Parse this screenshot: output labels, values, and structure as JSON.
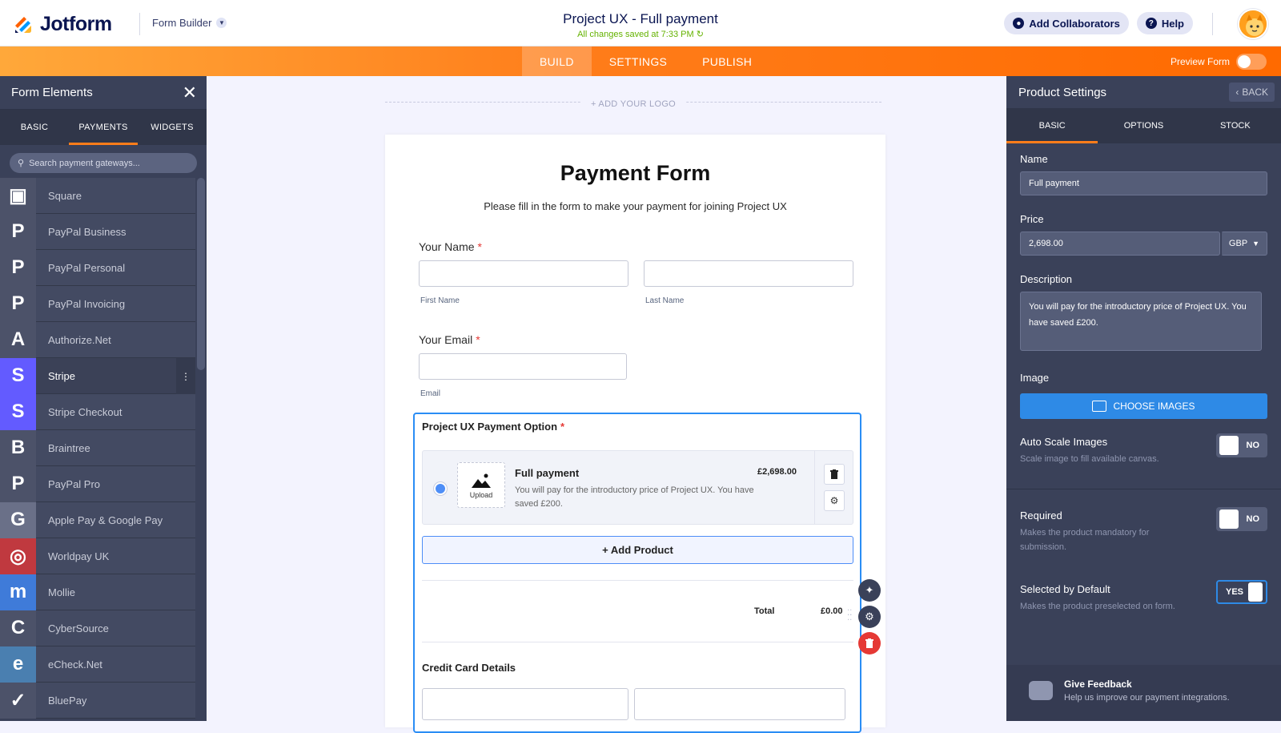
{
  "header": {
    "brand": "Jotform",
    "builder_label": "Form Builder",
    "form_title": "Project UX - Full payment",
    "saved_status": "All changes saved at 7:33 PM",
    "add_collaborators": "Add Collaborators",
    "help": "Help"
  },
  "navbar": {
    "tabs": [
      "BUILD",
      "SETTINGS",
      "PUBLISH"
    ],
    "active_tab": "BUILD",
    "preview_label": "Preview Form",
    "preview_on": false
  },
  "left_panel": {
    "title": "Form Elements",
    "tabs": [
      "BASIC",
      "PAYMENTS",
      "WIDGETS"
    ],
    "active_tab": "PAYMENTS",
    "search_placeholder": "Search payment gateways...",
    "gateways": [
      {
        "name": "Square",
        "icon": "square-icon",
        "color": "#4c5269",
        "glyph": "▣"
      },
      {
        "name": "PayPal Business",
        "icon": "paypal-icon",
        "color": "#4c5269",
        "glyph": "P"
      },
      {
        "name": "PayPal Personal",
        "icon": "paypal-icon",
        "color": "#4c5269",
        "glyph": "P"
      },
      {
        "name": "PayPal Invoicing",
        "icon": "paypal-icon",
        "color": "#4c5269",
        "glyph": "P"
      },
      {
        "name": "Authorize.Net",
        "icon": "authorize-net-icon",
        "color": "#4c5269",
        "glyph": "A"
      },
      {
        "name": "Stripe",
        "icon": "stripe-icon",
        "color": "#635bff",
        "glyph": "S"
      },
      {
        "name": "Stripe Checkout",
        "icon": "stripe-checkout-icon",
        "color": "#635bff",
        "glyph": "S"
      },
      {
        "name": "Braintree",
        "icon": "braintree-icon",
        "color": "#4c5269",
        "glyph": "B"
      },
      {
        "name": "PayPal Pro",
        "icon": "paypal-pro-icon",
        "color": "#4c5269",
        "glyph": "P"
      },
      {
        "name": "Apple Pay & Google Pay",
        "icon": "apple-google-pay-icon",
        "color": "#6a7088",
        "glyph": "G"
      },
      {
        "name": "Worldpay UK",
        "icon": "worldpay-icon",
        "color": "#c0393f",
        "glyph": "◎"
      },
      {
        "name": "Mollie",
        "icon": "mollie-icon",
        "color": "#3f7bd9",
        "glyph": "m"
      },
      {
        "name": "CyberSource",
        "icon": "cybersource-icon",
        "color": "#4c5269",
        "glyph": "C"
      },
      {
        "name": "eCheck.Net",
        "icon": "echeck-icon",
        "color": "#4a7fb0",
        "glyph": "e"
      },
      {
        "name": "BluePay",
        "icon": "bluepay-icon",
        "color": "#4c5269",
        "glyph": "✓"
      }
    ],
    "active_gateway": "Stripe"
  },
  "canvas": {
    "add_logo": "+ ADD YOUR LOGO",
    "form_heading": "Payment Form",
    "form_subheading": "Please fill in the form to make your payment for joining Project UX",
    "name_label": "Your Name",
    "first_name": "First Name",
    "last_name": "Last Name",
    "email_label": "Your Email",
    "email_sub": "Email",
    "payment_title": "Project UX Payment Option",
    "product": {
      "name": "Full payment",
      "price": "£2,698.00",
      "description": "You will pay for the introductory price of Project UX. You have saved £200.",
      "upload": "Upload"
    },
    "add_product": "+ Add Product",
    "total_label": "Total",
    "total_value": "£0.00",
    "cc_title": "Credit Card Details"
  },
  "right_panel": {
    "title": "Product Settings",
    "back": "BACK",
    "tabs": [
      "BASIC",
      "OPTIONS",
      "STOCK"
    ],
    "active_tab": "BASIC",
    "name_label": "Name",
    "name_value": "Full payment",
    "price_label": "Price",
    "price_value": "2,698.00",
    "currency": "GBP",
    "description_label": "Description",
    "description_value": "You will pay for the introductory price of Project UX. You have saved £200.",
    "image_label": "Image",
    "choose_images": "CHOOSE IMAGES",
    "auto_scale_label": "Auto Scale Images",
    "auto_scale_help": "Scale image to fill available canvas.",
    "auto_scale_value": "NO",
    "required_label": "Required",
    "required_help": "Makes the product mandatory for submission.",
    "required_value": "NO",
    "selected_label": "Selected by Default",
    "selected_help": "Makes the product preselected on form.",
    "selected_value": "YES",
    "feedback_title": "Give Feedback",
    "feedback_sub": "Help us improve our payment integrations."
  }
}
